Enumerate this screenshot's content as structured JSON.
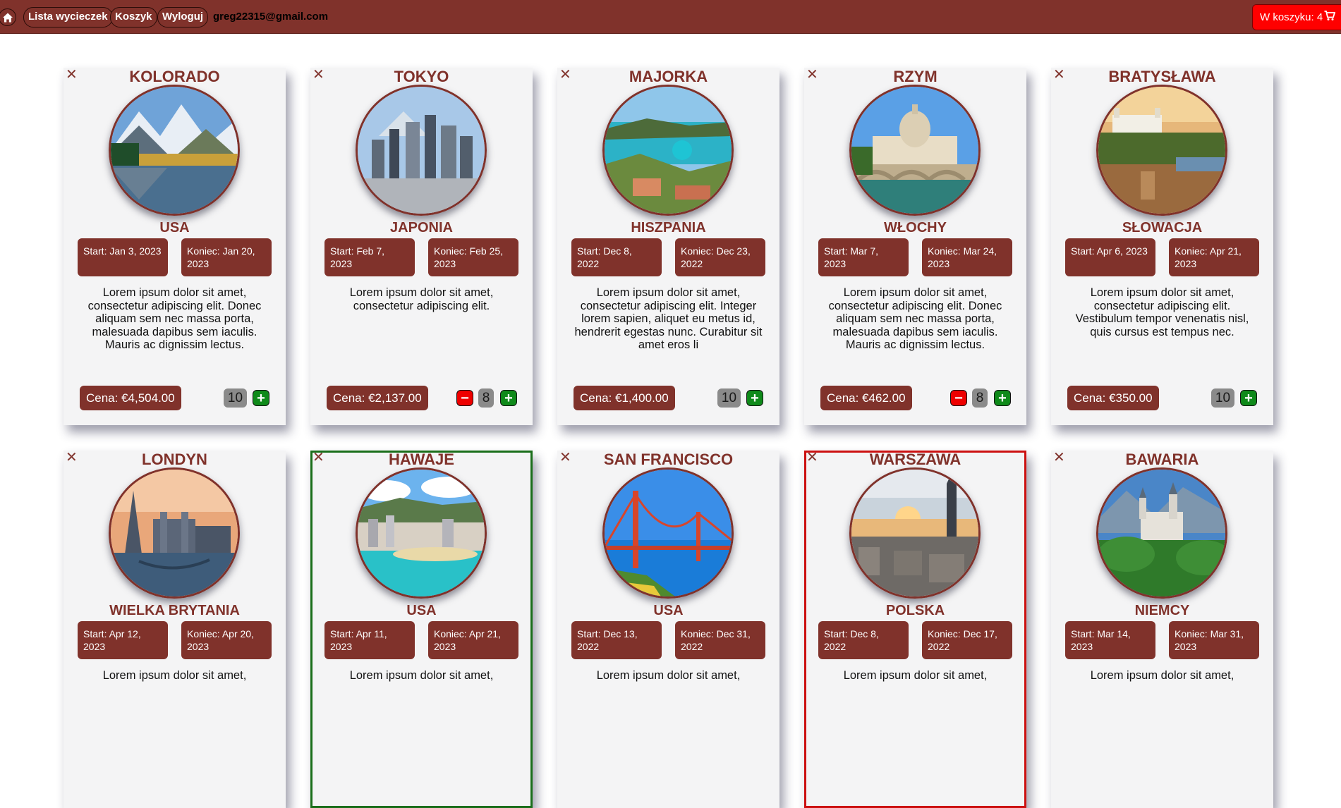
{
  "nav": {
    "home_icon": "home-icon",
    "links": [
      "Lista wycieczek",
      "Koszyk",
      "Wyloguj"
    ],
    "email": "greg22315@gmail.com",
    "cart_label": "W koszyku: 4",
    "cart_icon": "shopping-cart-icon"
  },
  "colors": {
    "brand": "#80322b",
    "cart": "#ff0000",
    "plus": "#0f8a1a",
    "minus": "#ee0000",
    "highlight_cheapest": "#1a6e1a",
    "highlight_most_expensive": "#cc1111"
  },
  "trips": [
    {
      "name": "KOLORADO",
      "country": "USA",
      "start": "Start: Jan 3, 2023",
      "end": "Koniec: Jan 20, 2023",
      "description": "Lorem ipsum dolor sit amet, consectetur adipiscing elit. Donec aliquam sem nec massa porta, malesuada dapibus sem iaculis. Mauris ac dignissim lectus.",
      "price": "Cena: €4,504.00",
      "qty": "10",
      "minus": false,
      "plus": true
    },
    {
      "name": "TOKYO",
      "country": "JAPONIA",
      "start": "Start: Feb 7, 2023",
      "end": "Koniec: Feb 25, 2023",
      "description": "Lorem ipsum dolor sit amet, consectetur adipiscing elit.",
      "price": "Cena: €2,137.00",
      "qty": "8",
      "minus": true,
      "plus": true
    },
    {
      "name": "MAJORKA",
      "country": "HISZPANIA",
      "start": "Start: Dec 8, 2022",
      "end": "Koniec: Dec 23, 2022",
      "description": "Lorem ipsum dolor sit amet, consectetur adipiscing elit. Integer lorem sapien, aliquet eu metus id, hendrerit egestas nunc. Curabitur sit amet eros li",
      "price": "Cena: €1,400.00",
      "qty": "10",
      "minus": false,
      "plus": true
    },
    {
      "name": "RZYM",
      "country": "WŁOCHY",
      "start": "Start: Mar 7, 2023",
      "end": "Koniec: Mar 24, 2023",
      "description": "Lorem ipsum dolor sit amet, consectetur adipiscing elit. Donec aliquam sem nec massa porta, malesuada dapibus sem iaculis. Mauris ac dignissim lectus.",
      "price": "Cena: €462.00",
      "qty": "8",
      "minus": true,
      "plus": true
    },
    {
      "name": "BRATYSŁAWA",
      "country": "SŁOWACJA",
      "start": "Start: Apr 6, 2023",
      "end": "Koniec: Apr 21, 2023",
      "description": "Lorem ipsum dolor sit amet, consectetur adipiscing elit. Vestibulum tempor venenatis nisl, quis cursus est tempus nec.",
      "price": "Cena: €350.00",
      "qty": "10",
      "minus": false,
      "plus": true
    },
    {
      "name": "LONDYN",
      "country": "WIELKA BRYTANIA",
      "start": "Start: Apr 12, 2023",
      "end": "Koniec: Apr 20, 2023",
      "description": "Lorem ipsum dolor sit amet,",
      "price": "",
      "qty": "",
      "minus": false,
      "plus": false
    },
    {
      "name": "HAWAJE",
      "country": "USA",
      "start": "Start: Apr 11, 2023",
      "end": "Koniec: Apr 21, 2023",
      "description": "Lorem ipsum dolor sit amet,",
      "price": "",
      "qty": "",
      "minus": false,
      "plus": false,
      "highlight": "cheapest"
    },
    {
      "name": "SAN FRANCISCO",
      "country": "USA",
      "start": "Start: Dec 13, 2022",
      "end": "Koniec: Dec 31, 2022",
      "description": "Lorem ipsum dolor sit amet,",
      "price": "",
      "qty": "",
      "minus": false,
      "plus": false
    },
    {
      "name": "WARSZAWA",
      "country": "POLSKA",
      "start": "Start: Dec 8, 2022",
      "end": "Koniec: Dec 17, 2022",
      "description": "Lorem ipsum dolor sit amet,",
      "price": "",
      "qty": "",
      "minus": false,
      "plus": false,
      "highlight": "most-expensive"
    },
    {
      "name": "BAWARIA",
      "country": "NIEMCY",
      "start": "Start: Mar 14, 2023",
      "end": "Koniec: Mar 31, 2023",
      "description": "Lorem ipsum dolor sit amet,",
      "price": "",
      "qty": "",
      "minus": false,
      "plus": false
    }
  ]
}
